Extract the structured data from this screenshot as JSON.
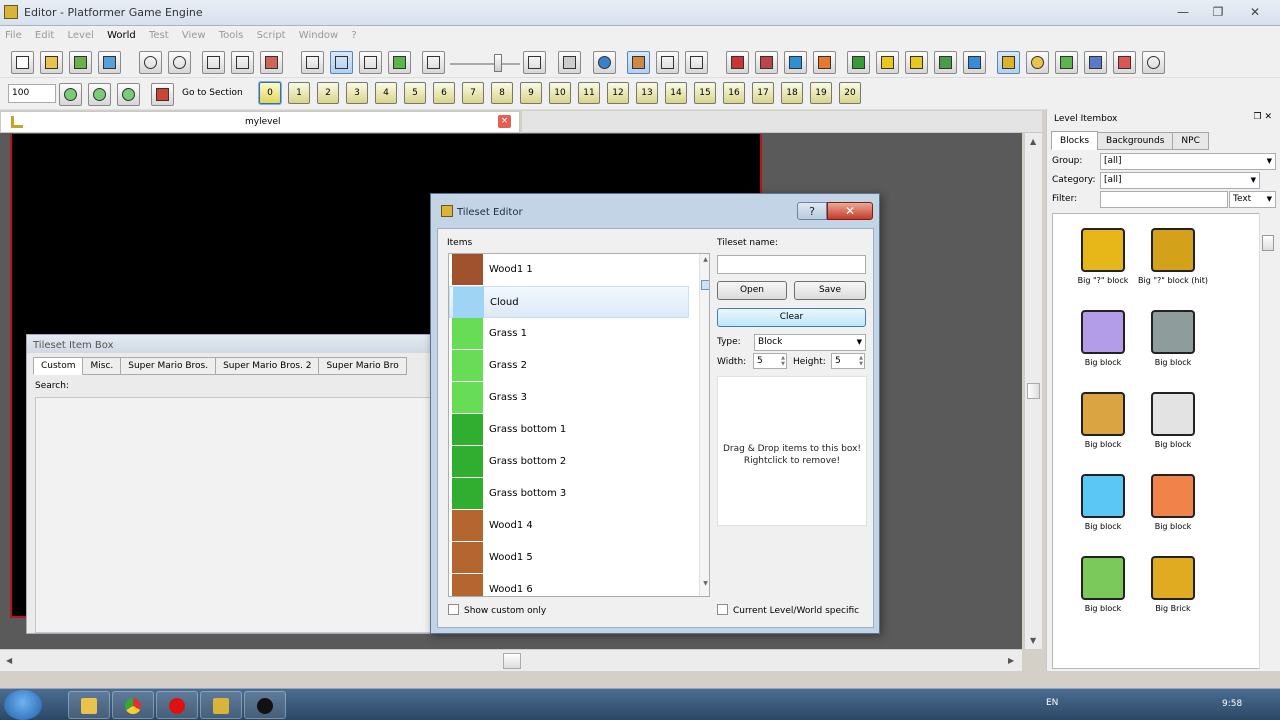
{
  "window": {
    "title": "Editor - Platformer Game Engine"
  },
  "menu": [
    "File",
    "Edit",
    "Level",
    "World",
    "Test",
    "View",
    "Tools",
    "Script",
    "Window",
    "?"
  ],
  "menu_active": [
    "World"
  ],
  "toolbar2": {
    "zoom": "100",
    "goto_section": "Go to Section"
  },
  "sections": [
    "0",
    "1",
    "2",
    "3",
    "4",
    "5",
    "6",
    "7",
    "8",
    "9",
    "10",
    "11",
    "12",
    "13",
    "14",
    "15",
    "16",
    "17",
    "18",
    "19",
    "20"
  ],
  "doc_tab": {
    "name": "mylevel",
    "close": "×"
  },
  "tileset_item_box": {
    "title": "Tileset Item Box",
    "tabs": [
      "Custom",
      "Misc.",
      "Super Mario Bros.",
      "Super Mario Bros. 2",
      "Super Mario Bro"
    ],
    "search_label": "Search:"
  },
  "tileset_editor": {
    "title": "Tileset Editor",
    "help": "?",
    "close": "✕",
    "items_label": "Items",
    "items": [
      {
        "label": "Wood1 1",
        "color": "#a0522d"
      },
      {
        "label": "Cloud",
        "color": "#9fd4f7"
      },
      {
        "label": "Grass 1",
        "color": "#66dd55"
      },
      {
        "label": "Grass 2",
        "color": "#66dd55"
      },
      {
        "label": "Grass 3",
        "color": "#66dd55"
      },
      {
        "label": "Grass bottom 1",
        "color": "#2fae2f"
      },
      {
        "label": "Grass bottom 2",
        "color": "#2fae2f"
      },
      {
        "label": "Grass bottom 3",
        "color": "#2fae2f"
      },
      {
        "label": "Wood1 4",
        "color": "#b5652f"
      },
      {
        "label": "Wood1 5",
        "color": "#b5652f"
      },
      {
        "label": "Wood1 6",
        "color": "#b5652f"
      }
    ],
    "show_custom_only": "Show custom only",
    "tileset_name_label": "Tileset name:",
    "tileset_name_value": "",
    "open": "Open",
    "save": "Save",
    "clear": "Clear",
    "type_label": "Type:",
    "type_value": "Block",
    "width_label": "Width:",
    "width_value": "5",
    "height_label": "Height:",
    "height_value": "5",
    "drop_hint_1": "Drag & Drop items to this box!",
    "drop_hint_2": "Rightclick to remove!",
    "current_level": "Current Level/World specific"
  },
  "itembox_panel": {
    "title": "Level Itembox",
    "tabs": [
      "Blocks",
      "Backgrounds",
      "NPC"
    ],
    "group_label": "Group:",
    "group_value": "[all]",
    "category_label": "Category:",
    "category_value": "[all]",
    "filter_label": "Filter:",
    "filter_mode": "Text",
    "blocks": [
      {
        "label": "Big \"?\" block",
        "color": "#e7b619"
      },
      {
        "label": "Big \"?\" block (hit)",
        "color": "#d4a21a"
      },
      {
        "label": "Big block",
        "color": "#b39ce8"
      },
      {
        "label": "Big block",
        "color": "#8e9c9b"
      },
      {
        "label": "Big block",
        "color": "#d9a441"
      },
      {
        "label": "Big block",
        "color": "#e3e3e3"
      },
      {
        "label": "Big block",
        "color": "#5bc7f5"
      },
      {
        "label": "Big block",
        "color": "#f0834a"
      },
      {
        "label": "Big block",
        "color": "#7bc95a"
      },
      {
        "label": "Big Brick",
        "color": "#e0aa21"
      }
    ]
  },
  "taskbar": {
    "lang": "EN",
    "time": "9:58"
  }
}
